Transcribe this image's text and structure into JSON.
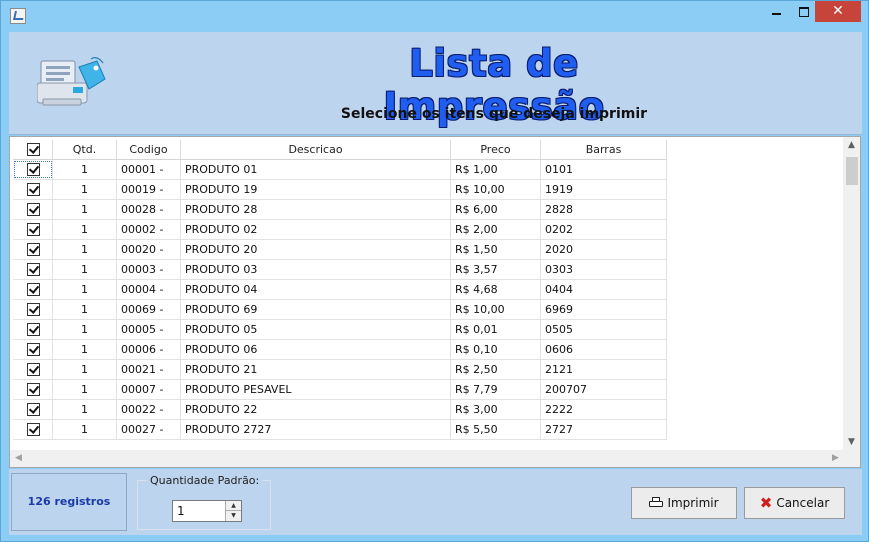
{
  "header": {
    "title": "Lista de Impressão",
    "subtitle": "Selecione os itens que deseja imprimir"
  },
  "grid": {
    "columns": [
      "Qtd.",
      "Codigo",
      "Descricao",
      "Preco",
      "Barras"
    ],
    "rows": [
      {
        "qtd": "1",
        "codigo": "00001 -",
        "descricao": "PRODUTO 01",
        "preco": "R$ 1,00",
        "barras": "0101"
      },
      {
        "qtd": "1",
        "codigo": "00019 -",
        "descricao": "PRODUTO 19",
        "preco": "R$ 10,00",
        "barras": "1919"
      },
      {
        "qtd": "1",
        "codigo": "00028 -",
        "descricao": "PRODUTO 28",
        "preco": "R$ 6,00",
        "barras": "2828"
      },
      {
        "qtd": "1",
        "codigo": "00002 -",
        "descricao": "PRODUTO 02",
        "preco": "R$ 2,00",
        "barras": "0202"
      },
      {
        "qtd": "1",
        "codigo": "00020 -",
        "descricao": "PRODUTO 20",
        "preco": "R$ 1,50",
        "barras": "2020"
      },
      {
        "qtd": "1",
        "codigo": "00003 -",
        "descricao": "PRODUTO 03",
        "preco": "R$ 3,57",
        "barras": "0303"
      },
      {
        "qtd": "1",
        "codigo": "00004 -",
        "descricao": "PRODUTO 04",
        "preco": "R$ 4,68",
        "barras": "0404"
      },
      {
        "qtd": "1",
        "codigo": "00069 -",
        "descricao": "PRODUTO 69",
        "preco": "R$ 10,00",
        "barras": "6969"
      },
      {
        "qtd": "1",
        "codigo": "00005 -",
        "descricao": "PRODUTO 05",
        "preco": "R$ 0,01",
        "barras": "0505"
      },
      {
        "qtd": "1",
        "codigo": "00006 -",
        "descricao": "PRODUTO 06",
        "preco": "R$ 0,10",
        "barras": "0606"
      },
      {
        "qtd": "1",
        "codigo": "00021 -",
        "descricao": "PRODUTO 21",
        "preco": "R$ 2,50",
        "barras": "2121"
      },
      {
        "qtd": "1",
        "codigo": "00007 -",
        "descricao": "PRODUTO PESAVEL",
        "preco": "R$ 7,79",
        "barras": "200707"
      },
      {
        "qtd": "1",
        "codigo": "00022 -",
        "descricao": "PRODUTO 22",
        "preco": "R$ 3,00",
        "barras": "2222"
      },
      {
        "qtd": "1",
        "codigo": "00027 -",
        "descricao": "PRODUTO 2727",
        "preco": "R$ 5,50",
        "barras": "2727"
      }
    ]
  },
  "footer": {
    "count_label": "126 registros",
    "qty_legend": "Quantidade Padrão:",
    "qty_value": "1",
    "print_label": "Imprimir",
    "cancel_label": "Cancelar"
  },
  "colors": {
    "title": "#1f5ef0",
    "window_frame": "#8ccdf5",
    "panel": "#bdd4ee",
    "count_text": "#1a3aa8",
    "close_button": "#c7443a"
  },
  "icons": {
    "app": "app-icon",
    "header": "printer-price-tag-icon",
    "print": "printer-icon",
    "cancel": "red-x-icon"
  }
}
